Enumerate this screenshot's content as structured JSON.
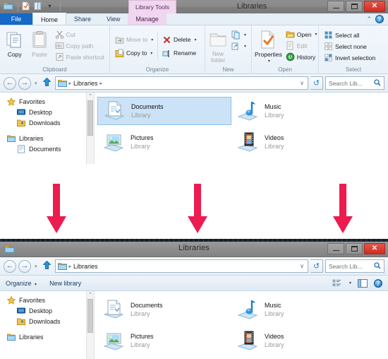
{
  "colors": {
    "arrow": "#ec1b50",
    "accent_blue": "#1569c7",
    "context_tab": "#f0d6ef",
    "selection": "#cce3f7",
    "close_red": "#cf2b20"
  },
  "top_window": {
    "title": "Libraries",
    "contextual_tab_group": "Library Tools",
    "quick_access": [
      {
        "name": "properties-qat-icon",
        "glyph": "▤"
      },
      {
        "name": "new-folder-qat-icon",
        "glyph": "▧"
      },
      {
        "name": "customize-qat-icon",
        "glyph": "▾"
      }
    ],
    "caption_buttons": {
      "minimize": "–",
      "maximize": "❐",
      "close": "✕"
    },
    "tabs": [
      {
        "label": "File",
        "state": "file"
      },
      {
        "label": "Home",
        "state": "active"
      },
      {
        "label": "Share",
        "state": "normal"
      },
      {
        "label": "View",
        "state": "normal"
      },
      {
        "label": "Manage",
        "state": "contextual"
      }
    ],
    "tab_right": {
      "collapse_ribbon": "⌃",
      "help": "?"
    },
    "ribbon_groups": [
      {
        "label": "Clipboard",
        "big_buttons": [
          {
            "label": "Copy",
            "icon": "copy-icon",
            "disabled": false
          },
          {
            "label": "Paste",
            "icon": "paste-icon",
            "disabled": true
          }
        ],
        "small_buttons": [
          {
            "label": "Cut",
            "icon": "scissors-icon",
            "disabled": true
          },
          {
            "label": "Copy path",
            "icon": "copy-path-icon",
            "disabled": true
          },
          {
            "label": "Paste shortcut",
            "icon": "paste-shortcut-icon",
            "disabled": true
          }
        ]
      },
      {
        "label": "Organize",
        "small_buttons": [
          {
            "label": "Move to",
            "icon": "move-to-icon",
            "disabled": true,
            "caret": true
          },
          {
            "label": "Copy to",
            "icon": "copy-to-icon",
            "disabled": false,
            "caret": true
          },
          {
            "label": "Delete",
            "icon": "delete-x-icon",
            "disabled": false,
            "caret": true
          },
          {
            "label": "Rename",
            "icon": "rename-icon",
            "disabled": false,
            "caret": false
          }
        ]
      },
      {
        "label": "New",
        "big_buttons": [
          {
            "label": "New\nfolder",
            "icon": "new-folder-icon",
            "disabled": true
          }
        ],
        "small_buttons": [
          {
            "label": "",
            "icon": "new-item-icon",
            "disabled": false,
            "caret": true
          },
          {
            "label": "",
            "icon": "easy-access-icon",
            "disabled": false,
            "caret": true
          }
        ]
      },
      {
        "label": "Open",
        "big_buttons": [
          {
            "label": "Properties",
            "icon": "properties-icon",
            "disabled": false,
            "caret": true
          }
        ],
        "small_buttons": [
          {
            "label": "Open",
            "icon": "open-icon",
            "disabled": false,
            "caret": true
          },
          {
            "label": "Edit",
            "icon": "edit-icon",
            "disabled": true
          },
          {
            "label": "History",
            "icon": "history-icon",
            "disabled": false
          }
        ]
      },
      {
        "label": "Select",
        "small_buttons": [
          {
            "label": "Select all",
            "icon": "select-all-icon",
            "disabled": false
          },
          {
            "label": "Select none",
            "icon": "select-none-icon",
            "disabled": false
          },
          {
            "label": "Invert selection",
            "icon": "invert-selection-icon",
            "disabled": false
          }
        ]
      }
    ],
    "navbar": {
      "back": "←",
      "forward": "→",
      "recent_caret": "▾",
      "up": "⬆",
      "breadcrumb": [
        "Libraries"
      ],
      "breadcrumb_sep": "▸",
      "address_dropdown": "∨",
      "refresh": "↺",
      "search_placeholder": "Search Lib...",
      "search_value": "",
      "search_icon": "🔍"
    },
    "sidebar": {
      "items": [
        {
          "label": "Favorites",
          "icon": "star-icon",
          "level": 0,
          "group": false
        },
        {
          "label": "Desktop",
          "icon": "desktop-icon",
          "level": 1,
          "group": false
        },
        {
          "label": "Downloads",
          "icon": "downloads-icon",
          "level": 1,
          "group": false
        },
        {
          "label": "Libraries",
          "icon": "library-icon",
          "level": 0,
          "group": true
        },
        {
          "label": "Documents",
          "icon": "documents-library-icon",
          "level": 1,
          "group": false
        }
      ],
      "scroll_up": "⌃"
    },
    "files": [
      {
        "name": "Documents",
        "sub": "Library",
        "icon": "documents-library-icon",
        "selected": true
      },
      {
        "name": "Music",
        "sub": "Library",
        "icon": "music-library-icon",
        "selected": false
      },
      {
        "name": "Pictures",
        "sub": "Library",
        "icon": "pictures-library-icon",
        "selected": false
      },
      {
        "name": "Videos",
        "sub": "Library",
        "icon": "videos-library-icon",
        "selected": false
      }
    ]
  },
  "arrows": {
    "count": 3,
    "direction": "down",
    "label": "red-down-arrow"
  },
  "bottom_window": {
    "title": "Libraries",
    "caption_buttons": {
      "minimize": "–",
      "maximize": "❐",
      "close": "✕"
    },
    "navbar": {
      "back": "←",
      "forward": "→",
      "recent_caret": "▾",
      "up": "⬆",
      "breadcrumb": [
        "Libraries"
      ],
      "breadcrumb_sep": "▸",
      "address_dropdown": "∨",
      "refresh": "↺",
      "search_placeholder": "Search Lib...",
      "search_value": "",
      "search_icon": "🔍"
    },
    "toolbar": {
      "organize": "Organize",
      "organize_caret": "▾",
      "new_library": "New library",
      "view_caret": "▾",
      "help": "?"
    },
    "sidebar": {
      "items": [
        {
          "label": "Favorites",
          "icon": "star-icon",
          "level": 0,
          "group": false
        },
        {
          "label": "Desktop",
          "icon": "desktop-icon",
          "level": 1,
          "group": false
        },
        {
          "label": "Downloads",
          "icon": "downloads-icon",
          "level": 1,
          "group": false
        },
        {
          "label": "Libraries",
          "icon": "library-icon",
          "level": 0,
          "group": true
        }
      ],
      "scroll_up": "⌃"
    },
    "files": [
      {
        "name": "Documents",
        "sub": "Library",
        "icon": "documents-library-icon",
        "selected": false
      },
      {
        "name": "Music",
        "sub": "Library",
        "icon": "music-library-icon",
        "selected": false
      },
      {
        "name": "Pictures",
        "sub": "Library",
        "icon": "pictures-library-icon",
        "selected": false
      },
      {
        "name": "Videos",
        "sub": "Library",
        "icon": "videos-library-icon",
        "selected": false
      }
    ]
  }
}
